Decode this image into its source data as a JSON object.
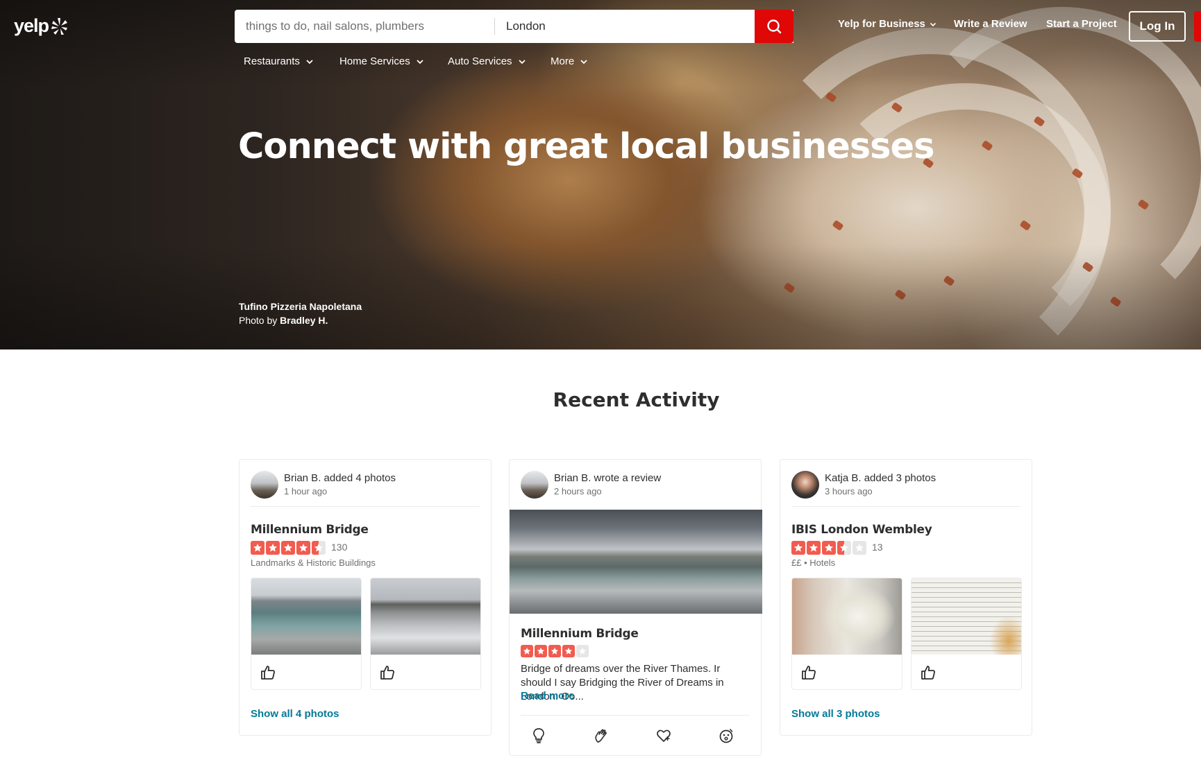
{
  "brand": {
    "logo_text": "yelp",
    "accent": "#e00707",
    "link_color": "#027a97",
    "star_color": "#f15c4f"
  },
  "search": {
    "find_placeholder": "things to do, nail salons, plumbers",
    "near_value": "London",
    "button_icon": "search-icon"
  },
  "topnav": {
    "business": "Yelp for Business",
    "write_review": "Write a Review",
    "start_project": "Start a Project",
    "login": "Log In"
  },
  "categories": [
    "Restaurants",
    "Home Services",
    "Auto Services",
    "More"
  ],
  "hero": {
    "title": "Connect with great local businesses",
    "photo_business": "Tufino Pizzeria Napoletana",
    "photo_by_prefix": "Photo by",
    "photo_by_name": "Bradley H."
  },
  "recent_activity": {
    "title": "Recent Activity",
    "cards": [
      {
        "actor": "Brian B. added 4 photos",
        "time": "1 hour ago",
        "business": "Millennium Bridge",
        "rating": 4.5,
        "review_count": "130",
        "category": "Landmarks & Historic Buildings",
        "show_all": "Show all 4 photos"
      },
      {
        "actor": "Brian B. wrote a review",
        "time": "2 hours ago",
        "business": "Millennium Bridge",
        "rating": 4,
        "review_text": "Bridge of dreams over the River Thames. Ir should I say Bridging the River of Dreams in London. Oo...",
        "read_more": "Read more",
        "reactions": [
          "useful-icon",
          "thanks-icon",
          "love-icon",
          "oh-no-icon"
        ]
      },
      {
        "actor": "Katja B. added 3 photos",
        "time": "3 hours ago",
        "business": "IBIS London Wembley",
        "rating": 3.5,
        "review_count": "13",
        "price": "££",
        "category": "Hotels",
        "show_all": "Show all 3 photos"
      }
    ]
  }
}
